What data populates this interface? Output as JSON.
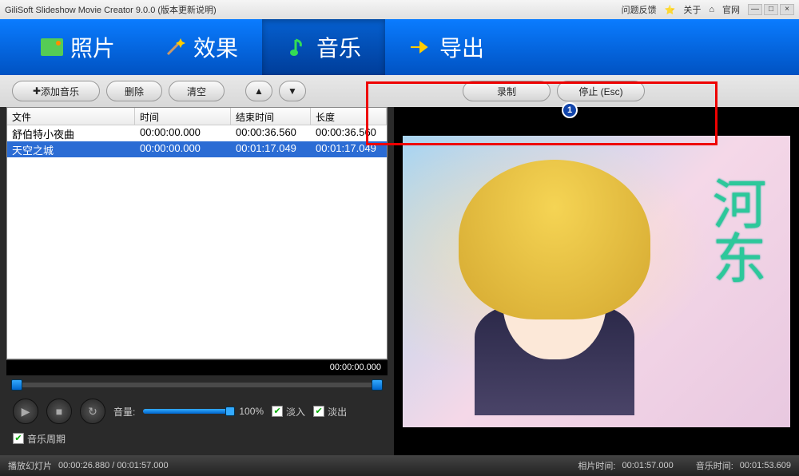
{
  "titlebar": {
    "app_title": "GiliSoft Slideshow Movie Creator 9.0.0 (版本更新说明)",
    "feedback": "问题反馈",
    "about": "关于",
    "website": "官网"
  },
  "nav": {
    "photos": "照片",
    "effects": "效果",
    "music": "音乐",
    "export": "导出"
  },
  "toolbar": {
    "add_music": "添加音乐",
    "delete": "删除",
    "clear": "清空",
    "record": "录制",
    "stop": "停止 (Esc)"
  },
  "table": {
    "headers": {
      "file": "文件",
      "time": "时间",
      "end_time": "结束时间",
      "length": "长度"
    },
    "rows": [
      {
        "file": "舒伯特小夜曲",
        "time": "00:00:00.000",
        "end": "00:00:36.560",
        "len": "00:00:36.560",
        "selected": false
      },
      {
        "file": "天空之城",
        "time": "00:00:00.000",
        "end": "00:01:17.049",
        "len": "00:01:17.049",
        "selected": true
      }
    ]
  },
  "player": {
    "timecode": "00:00:00.000",
    "volume_label": "音量:",
    "volume_pct": "100%",
    "fade_in": "淡入",
    "fade_out": "淡出",
    "loop": "音乐周期"
  },
  "preview": {
    "kanji": "河东"
  },
  "status": {
    "slideshow_label": "播放幻灯片",
    "slideshow_time": "00:00:26.880 / 00:01:57.000",
    "photo_time_label": "相片时间:",
    "photo_time": "00:01:57.000",
    "music_time_label": "音乐时间:",
    "music_time": "00:01:53.609"
  },
  "badge": "1"
}
